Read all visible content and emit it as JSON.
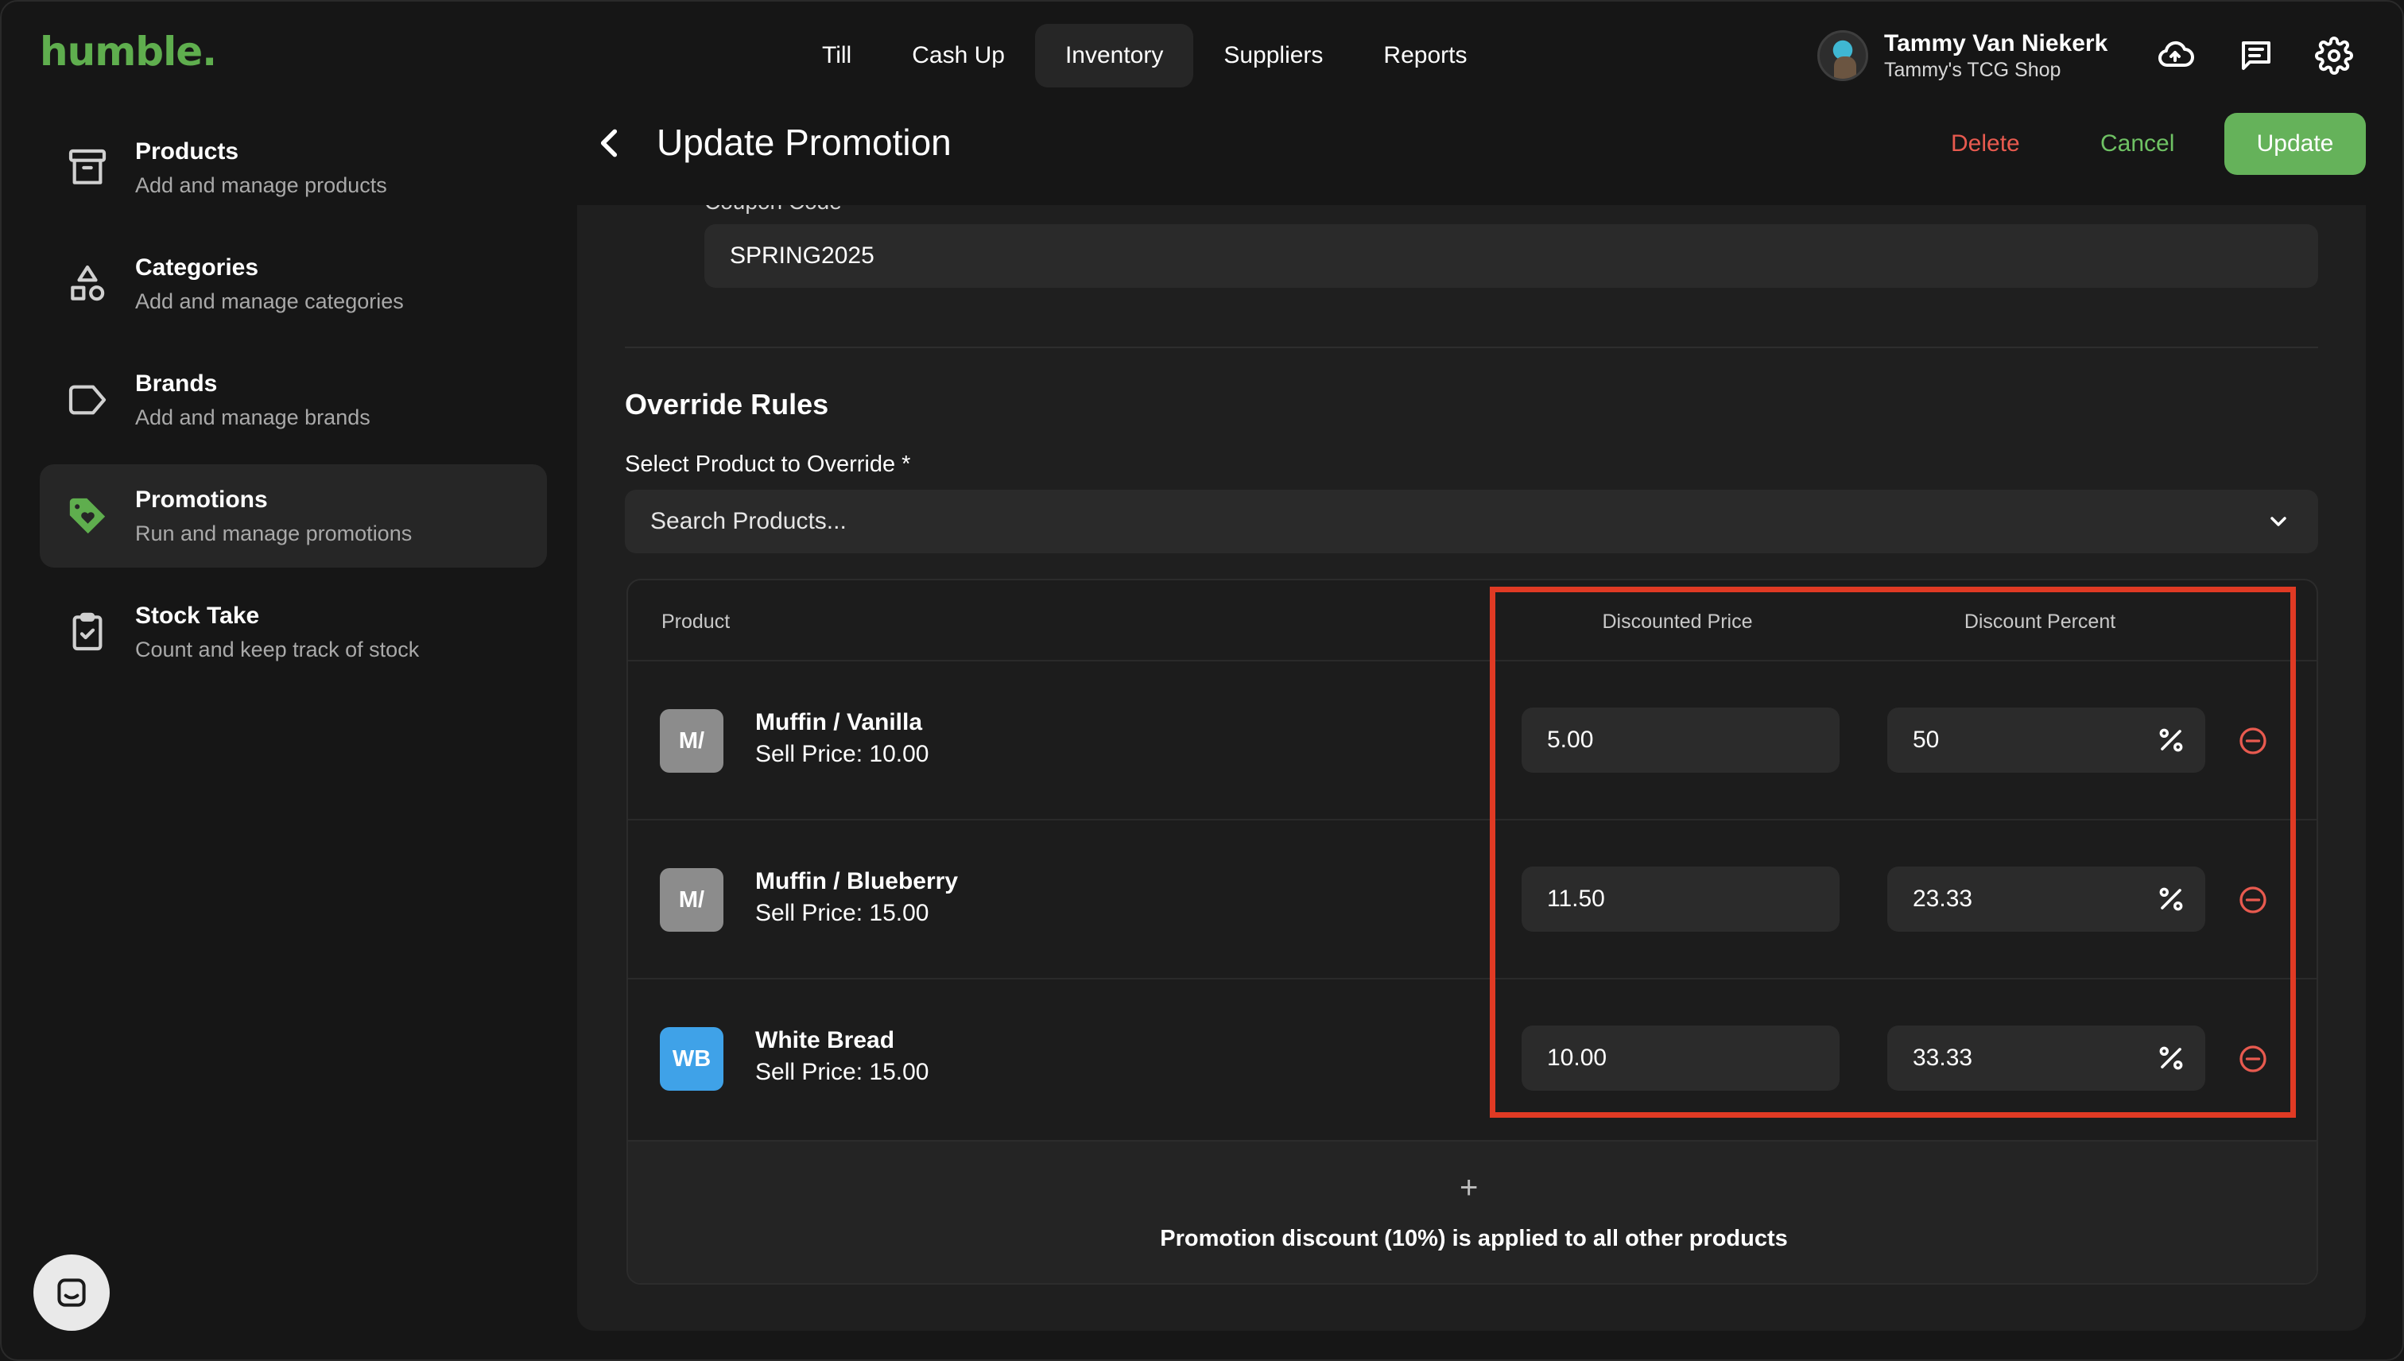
{
  "app": {
    "logo": "humble."
  },
  "nav": {
    "tabs": [
      {
        "label": "Till"
      },
      {
        "label": "Cash Up"
      },
      {
        "label": "Inventory",
        "active": true
      },
      {
        "label": "Suppliers"
      },
      {
        "label": "Reports"
      }
    ]
  },
  "user": {
    "name": "Tammy Van Niekerk",
    "shop": "Tammy's TCG Shop"
  },
  "top_icons": [
    "cloud-upload-icon",
    "message-icon",
    "gear-icon"
  ],
  "sidebar": {
    "items": [
      {
        "title": "Products",
        "subtitle": "Add and manage products",
        "icon": "archive-box-icon"
      },
      {
        "title": "Categories",
        "subtitle": "Add and manage categories",
        "icon": "shapes-icon"
      },
      {
        "title": "Brands",
        "subtitle": "Add and manage brands",
        "icon": "tag-outline-icon"
      },
      {
        "title": "Promotions",
        "subtitle": "Run and manage promotions",
        "icon": "tag-heart-icon",
        "active": true
      },
      {
        "title": "Stock Take",
        "subtitle": "Count and keep track of stock",
        "icon": "clipboard-check-icon"
      }
    ]
  },
  "page": {
    "title": "Update Promotion",
    "actions": {
      "delete": "Delete",
      "cancel": "Cancel",
      "update": "Update"
    }
  },
  "form": {
    "coupon_label": "Coupon Code",
    "coupon_value": "SPRING2025",
    "override_title": "Override Rules",
    "select_label": "Select Product to Override *",
    "select_placeholder": "Search Products..."
  },
  "table": {
    "headers": {
      "product": "Product",
      "discounted_price": "Discounted Price",
      "discount_percent": "Discount Percent"
    },
    "rows": [
      {
        "badge": "M/",
        "name": "Muffin / Vanilla",
        "sell_price": "Sell Price: 10.00",
        "discounted_price": "5.00",
        "discount_percent": "50"
      },
      {
        "badge": "M/",
        "name": "Muffin / Blueberry",
        "sell_price": "Sell Price: 15.00",
        "discounted_price": "11.50",
        "discount_percent": "23.33"
      },
      {
        "badge": "WB",
        "name": "White Bread",
        "sell_price": "Sell Price: 15.00",
        "discounted_price": "10.00",
        "discount_percent": "33.33"
      }
    ],
    "add_symbol": "+",
    "footer_note": "Promotion discount (10%) is applied to all other products"
  },
  "colors": {
    "brand_green": "#5fae4e",
    "update_button": "#65b25a",
    "delete_red": "#e85a4f",
    "cancel_green": "#6fc264",
    "badge_gray": "#8c8c8c",
    "badge_blue": "#3fa2e8",
    "highlight_red": "#e03a24"
  }
}
